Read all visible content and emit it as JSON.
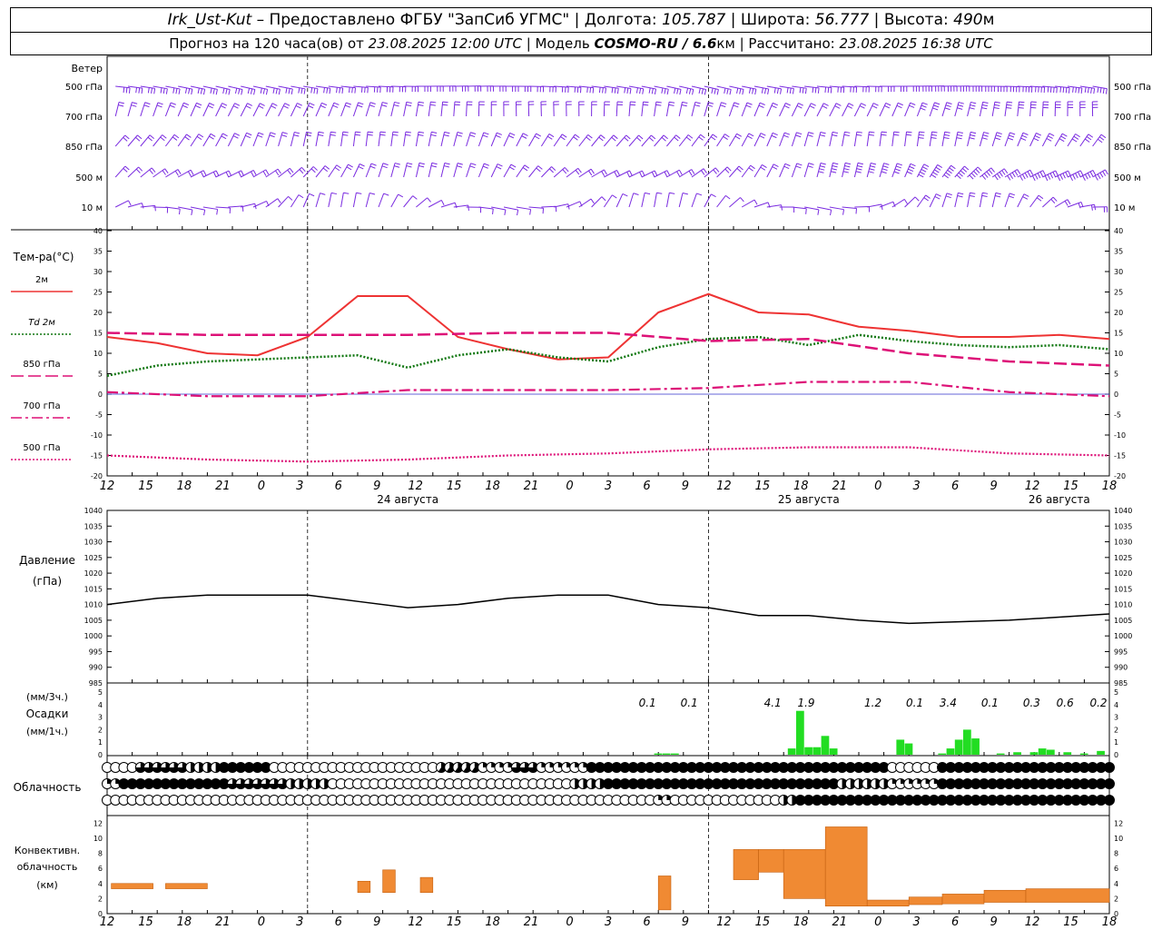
{
  "header": {
    "station": "Irk_Ust-Kut",
    "dash": " – ",
    "provided": "Предоставлено ФГБУ \"ЗапСиб УГМС\"",
    "sep": " | ",
    "lon_label": "Долгота: ",
    "lon": "105.787",
    "lat_label": "Широта: ",
    "lat": "56.777",
    "alt_label": "Высота: ",
    "alt": "490",
    "alt_unit": "м",
    "forecast_label": "Прогноз на 120 часа(ов) от ",
    "forecast_time": "23.08.2025 12:00 UTC",
    "model_label": "Модель ",
    "model": "COSMO-RU / 6.6",
    "model_unit": "км",
    "calc_label": "Рассчитано: ",
    "calc_time": "23.08.2025 16:38 UTC"
  },
  "panels": {
    "wind": {
      "title": "Ветер",
      "levels": [
        "500 гПа",
        "700 гПа",
        "850 гПа",
        "500 м",
        "10 м"
      ],
      "barb_color": "#7a2be0"
    },
    "temperature": {
      "title": "Тем-ра(°C)",
      "legend": [
        {
          "label": "2м",
          "color": "#ee3333",
          "style": "solid"
        },
        {
          "label": "Td 2м",
          "color": "#117711",
          "style": "dotted"
        },
        {
          "label": "850 гПа",
          "color": "#dd1177",
          "style": "dashed"
        },
        {
          "label": "700 гПа",
          "color": "#dd1177",
          "style": "dashdot"
        },
        {
          "label": "500 гПа",
          "color": "#dd1177",
          "style": "dotted"
        }
      ],
      "yticks": [
        "40",
        "35",
        "30",
        "25",
        "20",
        "15",
        "10",
        "5",
        "0",
        "-5",
        "-10",
        "-15",
        "-20"
      ]
    },
    "pressure": {
      "title_line1": "Давление",
      "title_line2": "(гПа)",
      "yticks": [
        "1040",
        "1035",
        "1030",
        "1025",
        "1020",
        "1015",
        "1010",
        "1005",
        "1000",
        "995",
        "990",
        "985"
      ]
    },
    "precip": {
      "title_line1": "(мм/3ч.)",
      "title_line2": "Осадки",
      "title_line3": "(мм/1ч.)",
      "yticks": [
        "5",
        "4",
        "3",
        "2",
        "1",
        "0"
      ],
      "totals": [
        "0.1",
        "0.1",
        "4.1",
        "1.9",
        "1.2",
        "0.1",
        "3.4",
        "0.1",
        "0.3",
        "0.6",
        "0.2"
      ]
    },
    "cloud": {
      "title": "Облачность"
    },
    "convective": {
      "title_line1": "Конвективн.",
      "title_line2": "облачность",
      "title_line3": "(км)",
      "yticks": [
        "12",
        "10",
        "8",
        "6",
        "4",
        "2",
        "0"
      ]
    }
  },
  "axis": {
    "hour_labels": [
      "12",
      "15",
      "18",
      "21",
      "0",
      "3",
      "6",
      "9",
      "12",
      "15",
      "18",
      "21",
      "0",
      "3",
      "6",
      "9",
      "12",
      "15",
      "18",
      "21",
      "0",
      "3",
      "6",
      "9",
      "12",
      "15",
      "18"
    ],
    "date_labels": [
      "24 августа",
      "25 августа",
      "26 августа"
    ]
  },
  "chart_data": [
    {
      "type": "line",
      "title": "Тем-ра(°C)",
      "ylim": [
        -20,
        40
      ],
      "x_unit": "hours from 23.08.2025 12:00 UTC",
      "series": [
        {
          "name": "2м",
          "x": [
            0,
            6,
            12,
            18,
            24,
            30,
            36,
            42,
            48,
            54,
            60,
            66,
            72,
            78,
            84,
            90,
            96,
            102,
            108,
            114,
            120
          ],
          "values": [
            14,
            12.5,
            10,
            9.5,
            14,
            24,
            24,
            14,
            11,
            8.5,
            9,
            20,
            24.5,
            20,
            19.5,
            16.5,
            15.5,
            14,
            14,
            14.5,
            13.5
          ]
        },
        {
          "name": "Td 2м",
          "x": [
            0,
            6,
            12,
            18,
            24,
            30,
            36,
            42,
            48,
            54,
            60,
            66,
            72,
            78,
            84,
            90,
            96,
            102,
            108,
            114,
            120
          ],
          "values": [
            4.5,
            7,
            8,
            8.5,
            9,
            9.5,
            6.5,
            9.5,
            11,
            9,
            8,
            11.5,
            13.5,
            14,
            12,
            14.5,
            13,
            12,
            11.5,
            12,
            11
          ]
        },
        {
          "name": "850 гПа",
          "x": [
            0,
            12,
            24,
            36,
            48,
            60,
            72,
            84,
            96,
            108,
            120
          ],
          "values": [
            15,
            14.5,
            14.5,
            14.5,
            15,
            15,
            13,
            13.5,
            10,
            8,
            7
          ]
        },
        {
          "name": "700 гПа",
          "x": [
            0,
            12,
            24,
            36,
            48,
            60,
            72,
            84,
            96,
            108,
            120
          ],
          "values": [
            0.5,
            -0.5,
            -0.5,
            1,
            1,
            1,
            1.5,
            3,
            3,
            0.5,
            -0.5
          ]
        },
        {
          "name": "500 гПа",
          "x": [
            0,
            12,
            24,
            36,
            48,
            60,
            72,
            84,
            96,
            108,
            120
          ],
          "values": [
            -15,
            -16,
            -16.5,
            -16,
            -15,
            -14.5,
            -13.5,
            -13,
            -13,
            -14.5,
            -15
          ]
        }
      ]
    },
    {
      "type": "line",
      "title": "Давление (гПа)",
      "ylim": [
        985,
        1040
      ],
      "series": [
        {
          "name": "Давление",
          "x": [
            0,
            6,
            12,
            18,
            24,
            30,
            36,
            42,
            48,
            54,
            60,
            66,
            72,
            78,
            84,
            90,
            96,
            102,
            108,
            114,
            120
          ],
          "values": [
            1010,
            1012,
            1013,
            1013,
            1013,
            1011,
            1009,
            1010,
            1012,
            1013,
            1013,
            1010,
            1009,
            1006.5,
            1006.5,
            1005,
            1004,
            1004.5,
            1005,
            1006,
            1007
          ]
        }
      ]
    },
    {
      "type": "bar",
      "title": "Осадки (мм/1ч.)",
      "ylim": [
        0,
        5
      ],
      "series": [
        {
          "name": "Осадки",
          "x": [
            66,
            67,
            68,
            82,
            83,
            84,
            85,
            86,
            87,
            88,
            95,
            96,
            100,
            101,
            102,
            103,
            104,
            107,
            109,
            111,
            112,
            113,
            115,
            117,
            119
          ],
          "values": [
            0.1,
            0.1,
            0.1,
            0.5,
            3.5,
            0.6,
            0.6,
            1.5,
            0.5,
            0.0,
            1.2,
            0.9,
            0.1,
            0.5,
            1.2,
            2.0,
            1.3,
            0.1,
            0.2,
            0.2,
            0.5,
            0.4,
            0.2,
            0.1,
            0.3
          ]
        }
      ]
    },
    {
      "type": "bar",
      "title": "Конвективн. облачность (км)",
      "ylim": [
        0,
        13
      ],
      "series": [
        {
          "name": "Конвективн. облачность",
          "bars": [
            {
              "x0": 0.5,
              "x1": 5.5,
              "lo": 3.3,
              "hi": 4.0
            },
            {
              "x0": 7,
              "x1": 12,
              "lo": 3.3,
              "hi": 4.0
            },
            {
              "x0": 30,
              "x1": 31.5,
              "lo": 2.8,
              "hi": 4.3
            },
            {
              "x0": 33,
              "x1": 34.5,
              "lo": 2.8,
              "hi": 5.8
            },
            {
              "x0": 37.5,
              "x1": 39,
              "lo": 2.8,
              "hi": 4.8
            },
            {
              "x0": 66,
              "x1": 67.5,
              "lo": 0.5,
              "hi": 5.0
            },
            {
              "x0": 75,
              "x1": 78,
              "lo": 4.5,
              "hi": 8.5
            },
            {
              "x0": 78,
              "x1": 81,
              "lo": 5.5,
              "hi": 8.5
            },
            {
              "x0": 81,
              "x1": 86,
              "lo": 2.0,
              "hi": 8.5
            },
            {
              "x0": 86,
              "x1": 91,
              "lo": 1.0,
              "hi": 11.5
            },
            {
              "x0": 91,
              "x1": 96,
              "lo": 1.0,
              "hi": 1.8
            },
            {
              "x0": 96,
              "x1": 100,
              "lo": 1.2,
              "hi": 2.2
            },
            {
              "x0": 100,
              "x1": 105,
              "lo": 1.3,
              "hi": 2.6
            },
            {
              "x0": 105,
              "x1": 110,
              "lo": 1.5,
              "hi": 3.1
            },
            {
              "x0": 110,
              "x1": 120,
              "lo": 1.5,
              "hi": 3.3
            }
          ]
        }
      ]
    }
  ]
}
